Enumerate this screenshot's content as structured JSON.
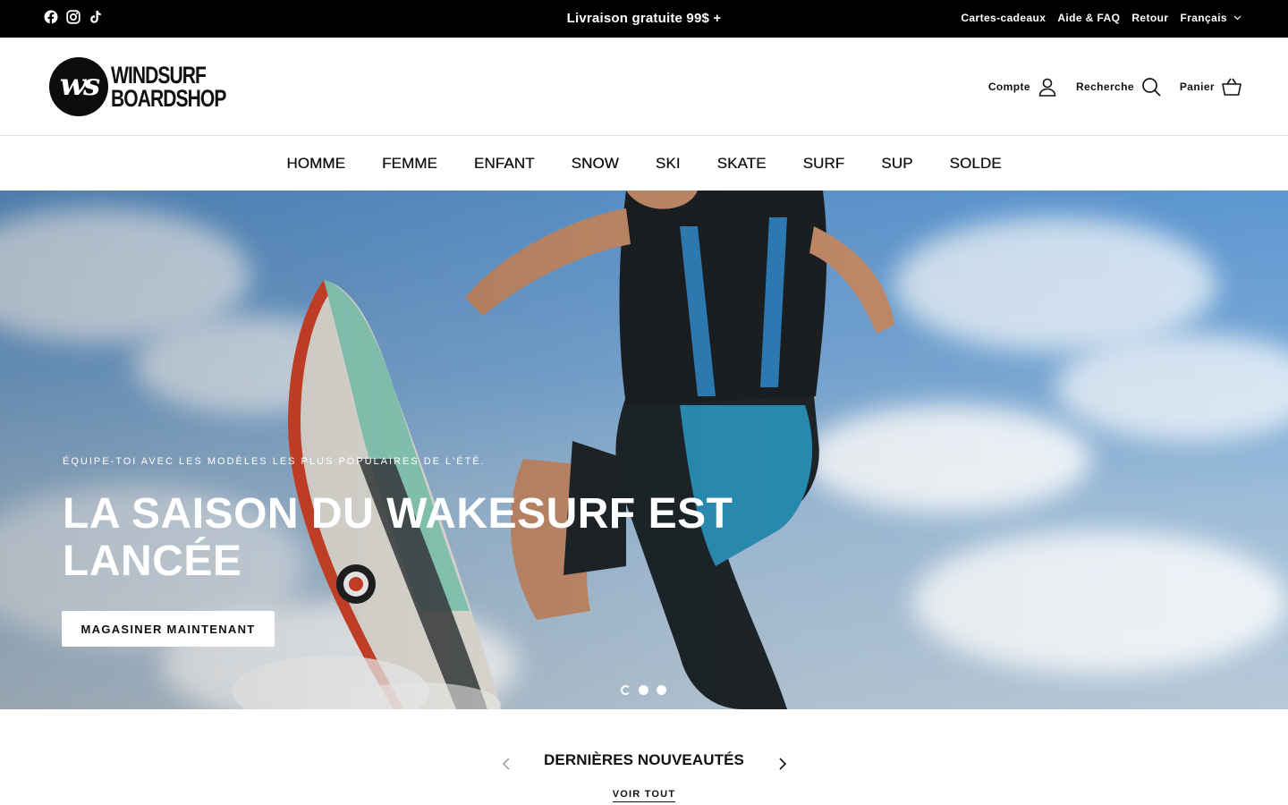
{
  "topbar": {
    "announcement": "Livraison gratuite 99$ +",
    "links": [
      "Cartes-cadeaux",
      "Aide & FAQ",
      "Retour"
    ],
    "language": "Français",
    "socials": [
      "facebook-icon",
      "instagram-icon",
      "tiktok-icon"
    ]
  },
  "brand": {
    "line1": "WINDSURF",
    "line2": "BOARDSHOP",
    "monogram": "ws"
  },
  "header": {
    "account": "Compte",
    "search": "Recherche",
    "cart": "Panier"
  },
  "nav": [
    "HOMME",
    "FEMME",
    "ENFANT",
    "SNOW",
    "SKI",
    "SKATE",
    "SURF",
    "SUP",
    "SOLDE"
  ],
  "hero": {
    "eyebrow": "ÉQUIPE-TOI AVEC LES MODÈLES LES PLUS POPULAIRES DE L'ÉTÉ.",
    "title": "LA SAISON DU WAKESURF EST LANCÉE",
    "cta": "MAGASINER MAINTENANT",
    "slides": 3,
    "active_slide": 1
  },
  "section": {
    "title": "DERNIÈRES NOUVEAUTÉS",
    "view_all": "VOIR TOUT"
  },
  "colors": {
    "topbar": "#000000",
    "text": "#111111",
    "sky": "#6fa3d6"
  }
}
